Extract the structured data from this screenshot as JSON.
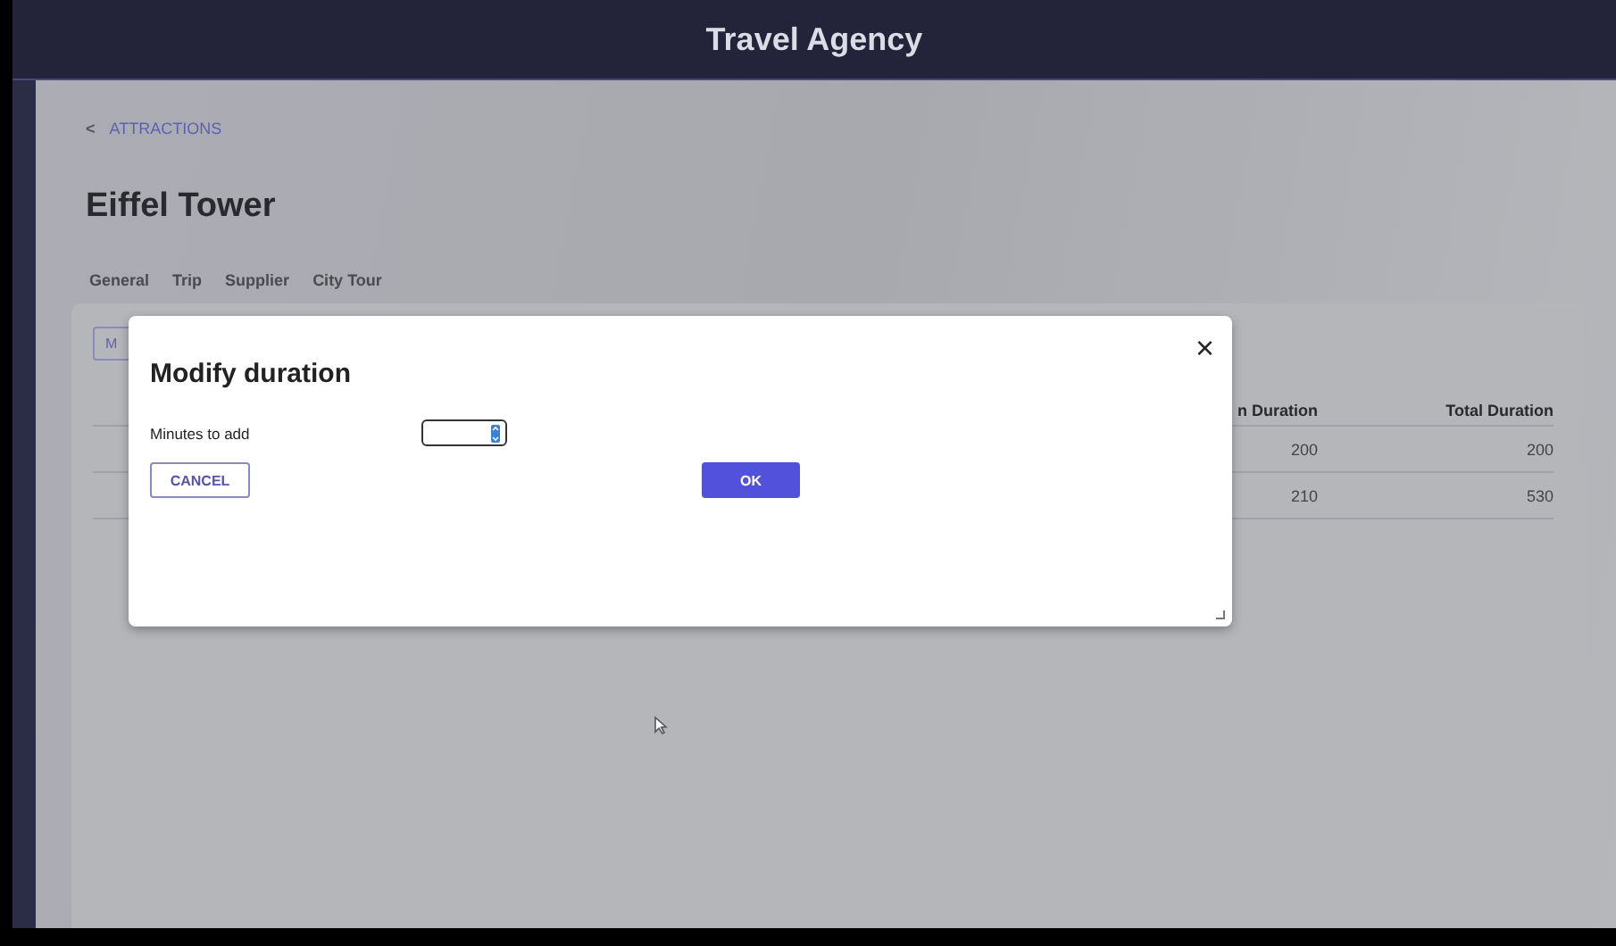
{
  "header": {
    "title": "Travel Agency"
  },
  "breadcrumb": {
    "icon": "<",
    "label": "ATTRACTIONS"
  },
  "page_title": "Eiffel Tower",
  "tabs": [
    "General",
    "Trip",
    "Supplier",
    "City Tour"
  ],
  "card": {
    "button": "M",
    "columns": [
      "n Duration",
      "Total Duration"
    ],
    "rows": [
      [
        "200",
        "200"
      ],
      [
        "210",
        "530"
      ]
    ]
  },
  "dialog": {
    "title": "Modify duration",
    "close": "×",
    "field_label": "Minutes to add",
    "cancel": "CANCEL",
    "ok": "OK"
  }
}
